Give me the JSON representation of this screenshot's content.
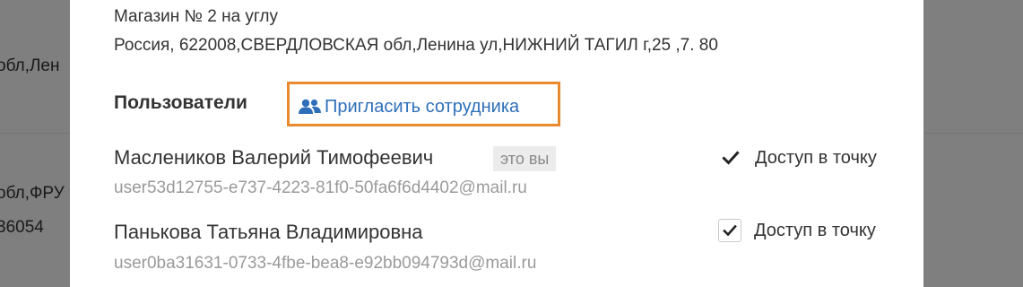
{
  "background": {
    "row1_text": "обл,Лен",
    "row2_text": "обл,ФРУ",
    "row3_text": "36054"
  },
  "store": {
    "name": "Магазин № 2 на углу",
    "address": "Россия, 622008,СВЕРДЛОВСКАЯ обл,Ленина ул,НИЖНИЙ ТАГИЛ г,25 ,7. 80"
  },
  "users_section": {
    "heading": "Пользователи",
    "invite_label": "Пригласить сотрудника",
    "invite_icon": "users-icon",
    "highlight_color": "#e88a2d",
    "link_color": "#2f6fba"
  },
  "users": [
    {
      "name": "Маслеников Валерий Тимофеевич",
      "badge": "это вы",
      "email": "user53d12755-e737-4223-81f0-50fa6f6d4402@mail.ru",
      "access_label": "Доступ в точку",
      "access_checked": true,
      "access_editable": false
    },
    {
      "name": "Панькова Татьяна Владимировна",
      "email": "user0ba31631-0733-4fbe-bea8-e92bb094793d@mail.ru",
      "access_label": "Доступ в точку",
      "access_checked": true,
      "access_editable": true
    }
  ]
}
